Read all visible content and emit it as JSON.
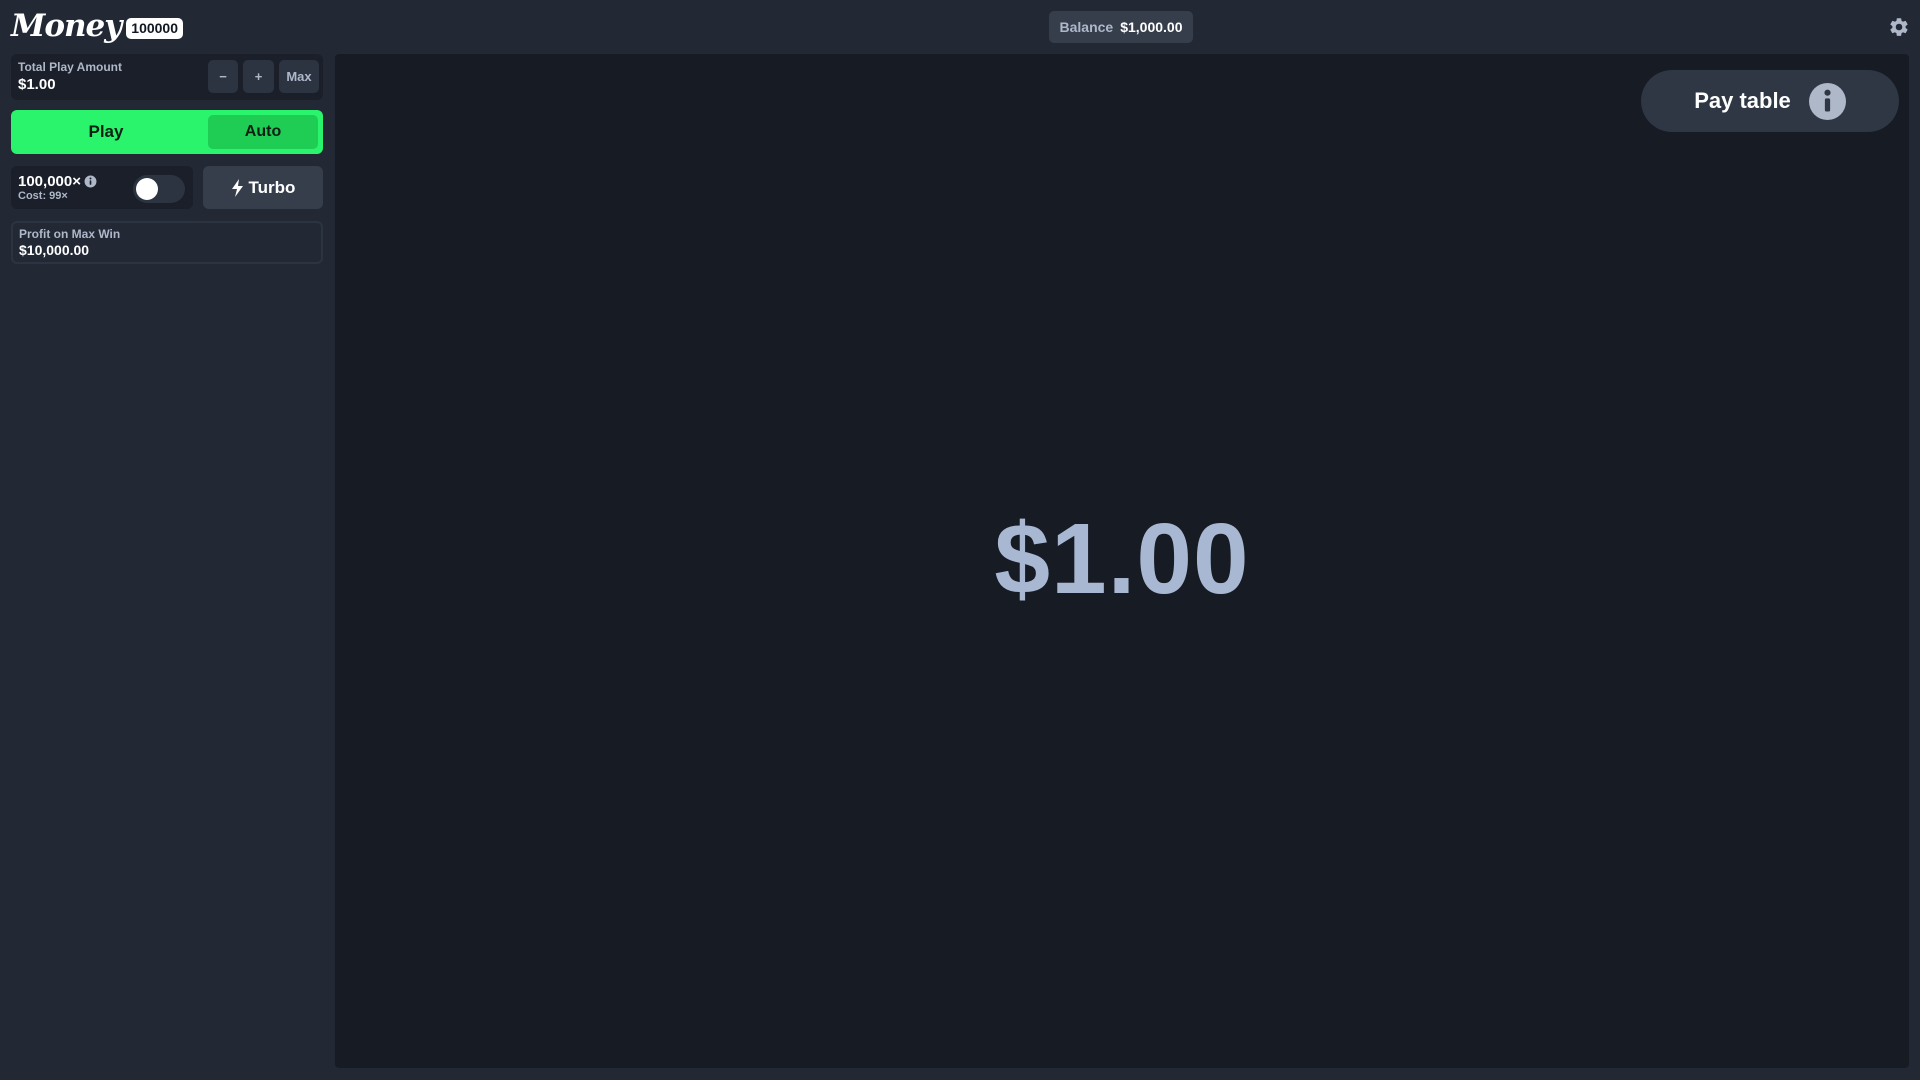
{
  "header": {
    "logo_text": "Money",
    "logo_badge": "100000",
    "balance_label": "Balance",
    "balance_value": "$1,000.00",
    "settings_icon": "gear-icon"
  },
  "sidebar": {
    "amount": {
      "label": "Total Play Amount",
      "value": "$1.00",
      "minus_label": "−",
      "plus_label": "+",
      "max_label": "Max"
    },
    "play_label": "Play",
    "auto_label": "Auto",
    "multiplier": {
      "value": "100,000×",
      "cost": "Cost: 99×",
      "toggle_on": false
    },
    "turbo_label": "Turbo",
    "profit": {
      "label": "Profit on Max Win",
      "value": "$10,000.00"
    }
  },
  "game": {
    "paytable_label": "Pay table",
    "display_amount": "$1.00"
  },
  "colors": {
    "background": "#222935",
    "game_background": "#171b23",
    "play_green": "#29f46b",
    "auto_green": "#1fcd55",
    "muted_text": "#aeb8c9",
    "big_amount": "#a9b8d2"
  }
}
